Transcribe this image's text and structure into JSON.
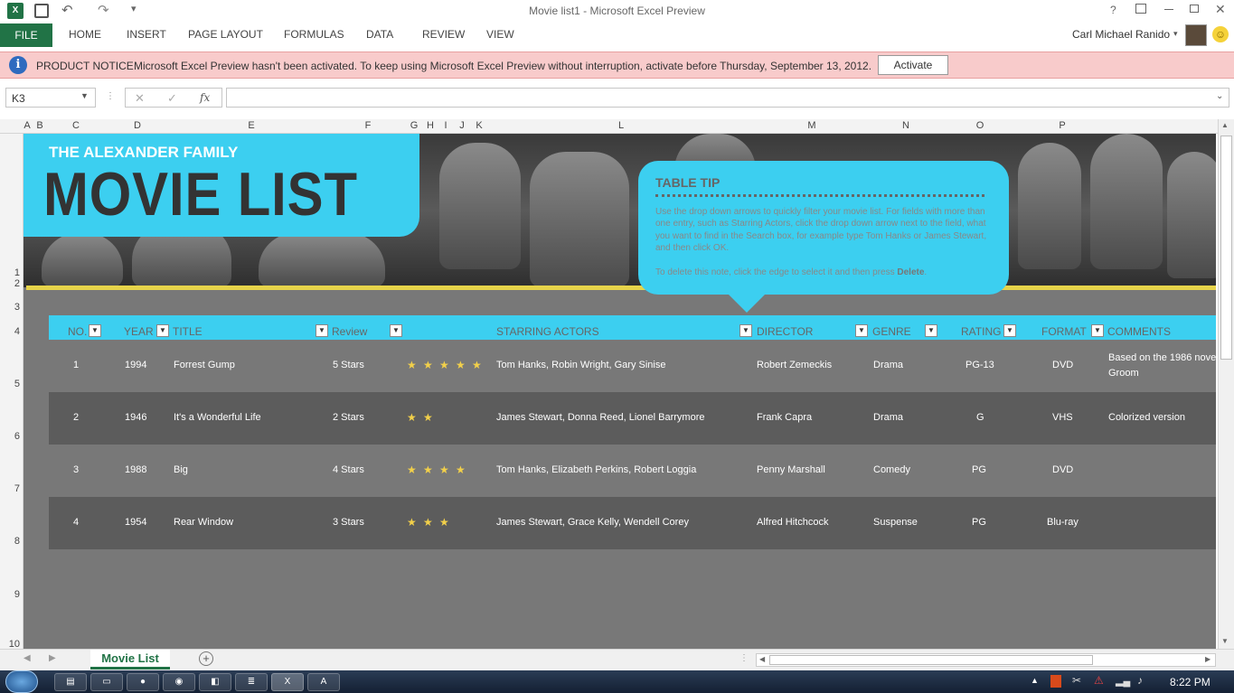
{
  "window": {
    "title": "Movie list1 - Microsoft Excel Preview",
    "help": "?",
    "user": "Carl Michael Ranido"
  },
  "ribbon": {
    "file": "FILE",
    "tabs": [
      "HOME",
      "INSERT",
      "PAGE LAYOUT",
      "FORMULAS",
      "DATA",
      "REVIEW",
      "VIEW"
    ]
  },
  "notice": {
    "label": "PRODUCT NOTICE",
    "message": "Microsoft Excel Preview hasn't been activated. To keep using Microsoft Excel Preview without interruption, activate before Thursday, September 13, 2012.",
    "button": "Activate"
  },
  "formula_bar": {
    "name_box": "K3",
    "fx": "fx",
    "value": ""
  },
  "columns": [
    "A",
    "B",
    "C",
    "D",
    "E",
    "F",
    "G",
    "H",
    "I",
    "J",
    "K",
    "L",
    "M",
    "N",
    "O",
    "P"
  ],
  "rows": [
    "1",
    "2",
    "3",
    "4",
    "5",
    "6",
    "7",
    "8",
    "9",
    "10"
  ],
  "banner": {
    "family": "THE ALEXANDER FAMILY",
    "title": "MOVIE LIST"
  },
  "tip": {
    "heading": "TABLE TIP",
    "body": "Use the drop down arrows to quickly filter your movie list. For fields with more than one entry, such as Starring Actors, click  the drop down arrow next to the field, what you want to find in the Search box, for example type Tom Hanks or James Stewart, and then click OK.",
    "delete_prefix": "To delete this note, click the edge to select it and then press ",
    "delete_word": "Delete",
    "delete_suffix": "."
  },
  "table": {
    "headers": {
      "no": "NO.",
      "year": "YEAR",
      "title": "TITLE",
      "review": "Review",
      "actors": "STARRING ACTORS",
      "director": "DIRECTOR",
      "genre": "GENRE",
      "rating": "RATING",
      "format": "FORMAT",
      "comments": "COMMENTS"
    },
    "rows": [
      {
        "no": "1",
        "year": "1994",
        "title": "Forrest Gump",
        "review": "5 Stars",
        "stars": 5,
        "actors": "Tom Hanks, Robin Wright, Gary Sinise",
        "director": "Robert Zemeckis",
        "genre": "Drama",
        "rating": "PG-13",
        "format": "DVD",
        "comments": "Based on the 1986 nove",
        "comments2": "Groom"
      },
      {
        "no": "2",
        "year": "1946",
        "title": "It's a Wonderful Life",
        "review": "2 Stars",
        "stars": 2,
        "actors": "James Stewart, Donna Reed, Lionel Barrymore",
        "director": "Frank Capra",
        "genre": "Drama",
        "rating": "G",
        "format": "VHS",
        "comments": "Colorized version",
        "comments2": ""
      },
      {
        "no": "3",
        "year": "1988",
        "title": "Big",
        "review": "4 Stars",
        "stars": 4,
        "actors": "Tom Hanks, Elizabeth Perkins, Robert Loggia",
        "director": "Penny Marshall",
        "genre": "Comedy",
        "rating": "PG",
        "format": "DVD",
        "comments": "",
        "comments2": ""
      },
      {
        "no": "4",
        "year": "1954",
        "title": "Rear Window",
        "review": "3 Stars",
        "stars": 3,
        "actors": "James Stewart, Grace Kelly, Wendell Corey",
        "director": "Alfred Hitchcock",
        "genre": "Suspense",
        "rating": "PG",
        "format": "Blu-ray",
        "comments": "",
        "comments2": ""
      }
    ]
  },
  "sheet_tab": "Movie List",
  "clock": "8:22 PM",
  "colors": {
    "accent": "#3ccff0",
    "excel_green": "#217346",
    "star": "#f2d04a"
  }
}
